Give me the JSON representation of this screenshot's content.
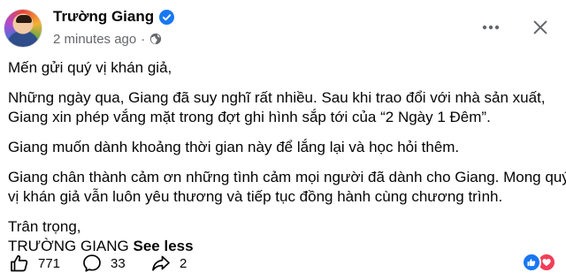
{
  "post": {
    "author": "Trường Giang",
    "timestamp": "2 minutes ago",
    "separator": "·",
    "audience_icon": "globe-icon",
    "more_icon": "ellipsis-icon",
    "close_icon": "close-icon",
    "verified_icon": "verified-badge-icon",
    "paragraphs": [
      "Mến gửi quý vị khán giả,",
      "Những ngày qua, Giang đã suy nghĩ rất nhiều. Sau khi trao đổi với nhà sản xuất,",
      "Giang xin phép vắng mặt trong đợt ghi hình sắp tới của “2 Ngày 1 Đêm”.",
      "Giang muốn dành khoảng thời gian này để lắng lại và học hỏi thêm.",
      "Giang chân thành cảm ơn những tình cảm mọi người đã dành cho Giang. Mong quý",
      "vị khán giả vẫn luôn yêu thương và tiếp tục đồng hành cùng chương trình.",
      "Trân trọng,",
      "TRƯỜNG GIANG"
    ],
    "see_less": "See less"
  },
  "actions": {
    "like": {
      "icon": "thumbs-up-icon",
      "count": "771"
    },
    "comment": {
      "icon": "comment-icon",
      "count": "33"
    },
    "share": {
      "icon": "share-icon",
      "count": "2"
    }
  },
  "reactions": [
    "like-reaction-icon",
    "love-reaction-icon"
  ],
  "colors": {
    "accent": "#1877f2",
    "love": "#f33e58",
    "muted": "#65676b",
    "text": "#050505"
  }
}
